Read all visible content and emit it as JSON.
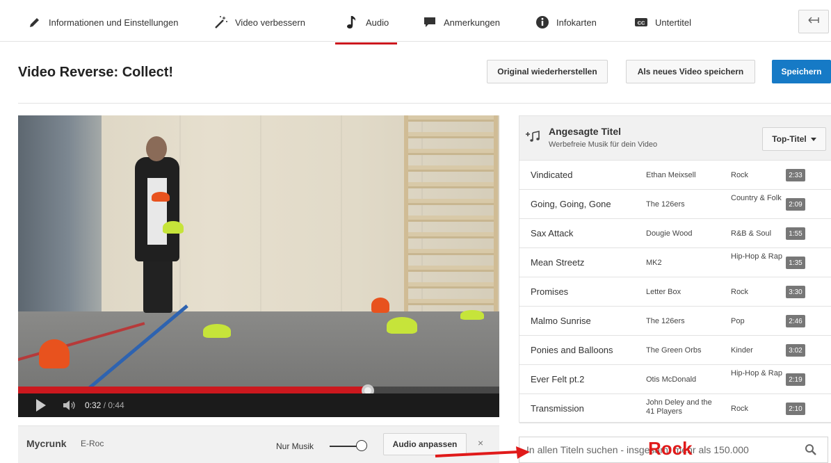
{
  "tabs": [
    {
      "label": "Informationen und Einstellungen",
      "icon": "pencil-icon"
    },
    {
      "label": "Video verbessern",
      "icon": "magic-wand-icon"
    },
    {
      "label": "Audio",
      "icon": "music-note-icon",
      "active": true
    },
    {
      "label": "Anmerkungen",
      "icon": "speech-bubble-icon"
    },
    {
      "label": "Infokarten",
      "icon": "info-icon"
    },
    {
      "label": "Untertitel",
      "icon": "cc-icon"
    }
  ],
  "header": {
    "title": "Video Reverse: Collect!",
    "restore_label": "Original wiederherstellen",
    "save_new_label": "Als neues Video speichern",
    "save_label": "Speichern"
  },
  "player": {
    "current_time": "0:32",
    "duration": "/ 0:44",
    "progress_fraction": 0.727
  },
  "music_bar": {
    "track": "Mycrunk",
    "artist": "E-Roc",
    "only_music_label": "Nur Musik",
    "adjust_label": "Audio anpassen",
    "close": "×"
  },
  "panel": {
    "title": "Angesagte Titel",
    "subtitle": "Werbefreie Musik für dein Video",
    "filter_label": "Top-Titel",
    "tracks": [
      {
        "title": "Vindicated",
        "artist": "Ethan Meixsell",
        "genre": "Rock",
        "duration": "2:33"
      },
      {
        "title": "Going, Going, Gone",
        "artist": "The 126ers",
        "genre": "Country & Folk",
        "duration": "2:09"
      },
      {
        "title": "Sax Attack",
        "artist": "Dougie Wood",
        "genre": "R&B & Soul",
        "duration": "1:55"
      },
      {
        "title": "Mean Streetz",
        "artist": "MK2",
        "genre": "Hip-Hop & Rap",
        "duration": "1:35"
      },
      {
        "title": "Promises",
        "artist": "Letter Box",
        "genre": "Rock",
        "duration": "3:30"
      },
      {
        "title": "Malmo Sunrise",
        "artist": "The 126ers",
        "genre": "Pop",
        "duration": "2:46"
      },
      {
        "title": "Ponies and Balloons",
        "artist": "The Green Orbs",
        "genre": "Kinder",
        "duration": "3:02"
      },
      {
        "title": "Ever Felt pt.2",
        "artist": "Otis McDonald",
        "genre": "Hip-Hop & Rap",
        "duration": "2:19"
      },
      {
        "title": "Transmission",
        "artist": "John Deley and the 41 Players",
        "genre": "Rock",
        "duration": "2:10"
      }
    ]
  },
  "search": {
    "placeholder": "In allen Titeln suchen - insgesamt mehr als 150.000"
  },
  "annotation": {
    "text": "Rock",
    "color": "#e01a1a"
  },
  "colors": {
    "accent_red": "#cc181e",
    "primary_blue": "#167ac6"
  }
}
